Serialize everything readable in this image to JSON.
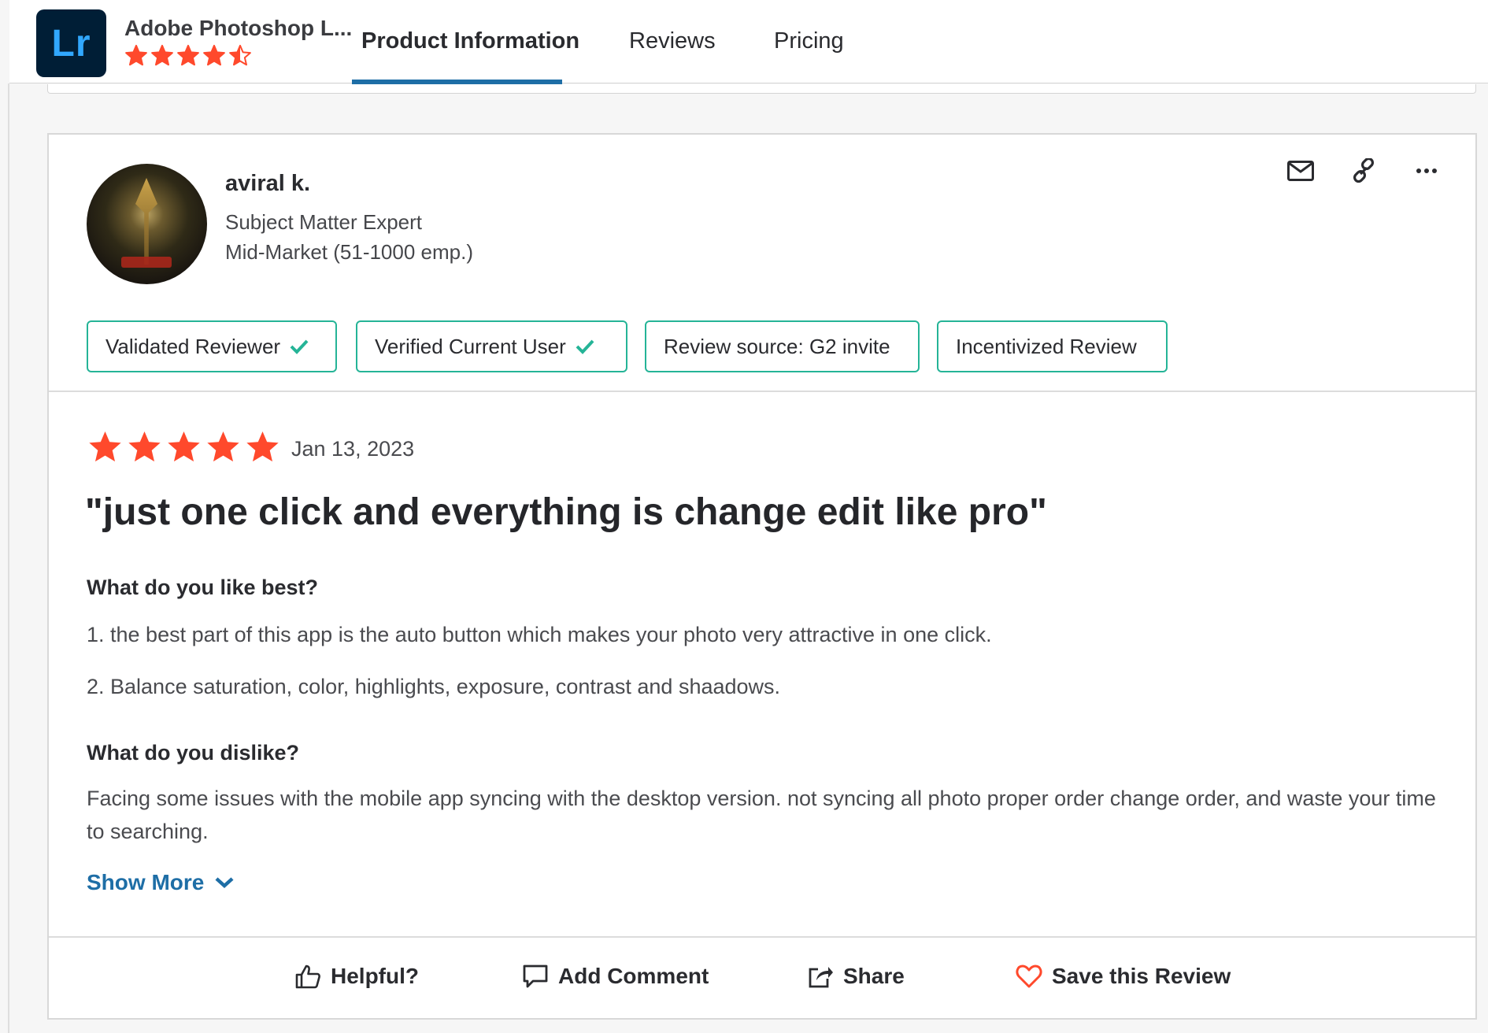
{
  "product": {
    "logo_text": "Lr",
    "name": "Adobe Photoshop L...",
    "rating": 4.5,
    "star_color": "#ff492c"
  },
  "nav": {
    "tabs": [
      {
        "label": "Product Information",
        "active": true
      },
      {
        "label": "Reviews",
        "active": false
      },
      {
        "label": "Pricing",
        "active": false
      }
    ],
    "accent_color": "#1e6ea6"
  },
  "reviewer": {
    "name": "aviral k.",
    "role": "Subject Matter Expert",
    "segment": "Mid-Market (51-1000 emp.)"
  },
  "header_actions": [
    {
      "icon": "mail-icon"
    },
    {
      "icon": "link-icon"
    },
    {
      "icon": "more-icon"
    }
  ],
  "badges": [
    {
      "label": "Validated Reviewer",
      "check": true
    },
    {
      "label": "Verified Current User",
      "check": true
    },
    {
      "label": "Review source: G2 invite",
      "check": false
    },
    {
      "label": "Incentivized Review",
      "check": false
    }
  ],
  "badge_border_color": "#25b497",
  "review": {
    "rating": 5,
    "date": "Jan 13, 2023",
    "title": "\"just one click and everything is change edit like pro\"",
    "like_heading": "What do you like best?",
    "like_points": [
      "1. the best part of this app is the auto button which makes your photo very attractive in one click.",
      "2. Balance saturation, color, highlights, exposure, contrast and shaadows."
    ],
    "dislike_heading": "What do you dislike?",
    "dislike_text": "Facing some issues with the mobile app syncing with the desktop version. not syncing all photo proper order change order, and waste your time to searching.",
    "show_more": "Show More"
  },
  "actions": [
    {
      "label": "Helpful?",
      "icon": "thumbs-up-icon"
    },
    {
      "label": "Add Comment",
      "icon": "comment-icon"
    },
    {
      "label": "Share",
      "icon": "share-icon"
    },
    {
      "label": "Save this Review",
      "icon": "heart-icon"
    }
  ]
}
